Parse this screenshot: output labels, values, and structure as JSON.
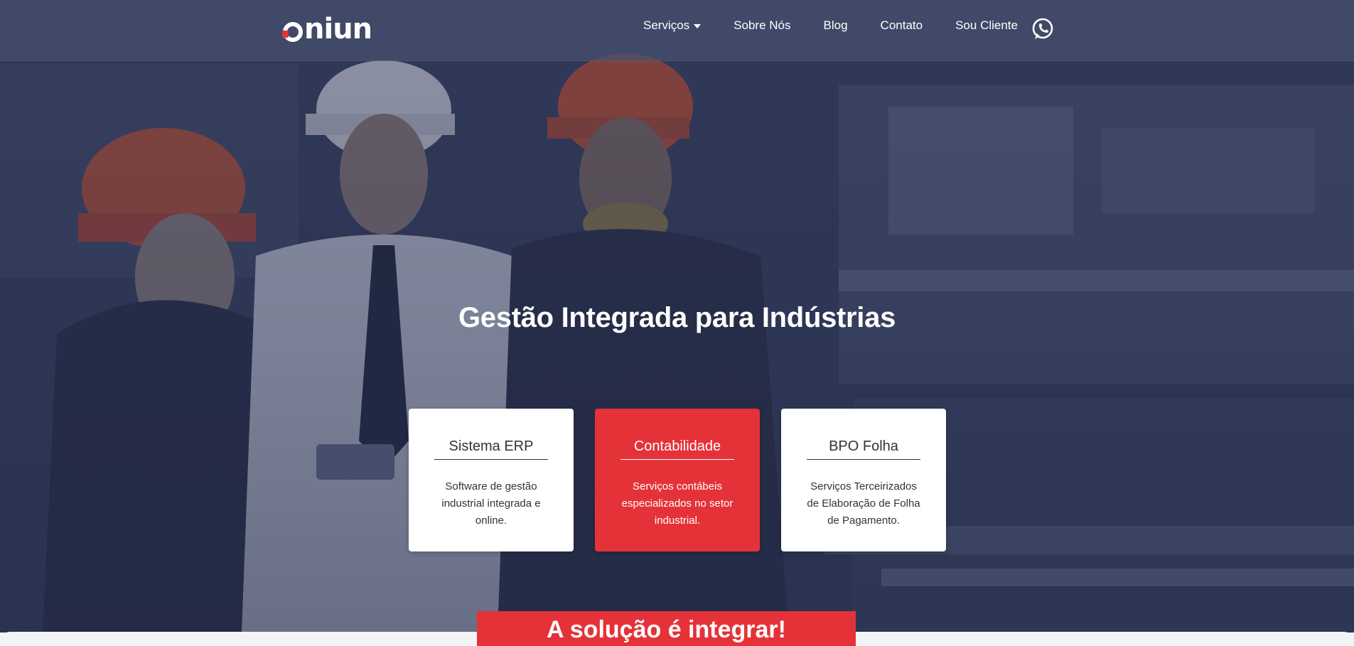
{
  "header": {
    "logo_text": "oniun",
    "nav": [
      {
        "label": "Serviços",
        "has_dropdown": true
      },
      {
        "label": "Sobre Nós"
      },
      {
        "label": "Blog"
      },
      {
        "label": "Contato"
      },
      {
        "label": "Sou Cliente"
      }
    ],
    "whatsapp_icon": "whatsapp-icon"
  },
  "hero": {
    "headline": "Gestão Integrada para Indústrias"
  },
  "cards": [
    {
      "title": "Sistema ERP",
      "description": "Software de gestão industrial integrada e online.",
      "active": false
    },
    {
      "title": "Contabilidade",
      "description": "Serviços contábeis especializados no setor industrial.",
      "active": true
    },
    {
      "title": "BPO Folha",
      "description": "Serviços Terceirizados de Elaboração de Folha de Pagamento.",
      "active": false
    }
  ],
  "cta": {
    "label": "A solução é integrar!"
  },
  "colors": {
    "accent": "#e53238",
    "overlay": "#2c3452",
    "header_bg": "#46506e"
  }
}
